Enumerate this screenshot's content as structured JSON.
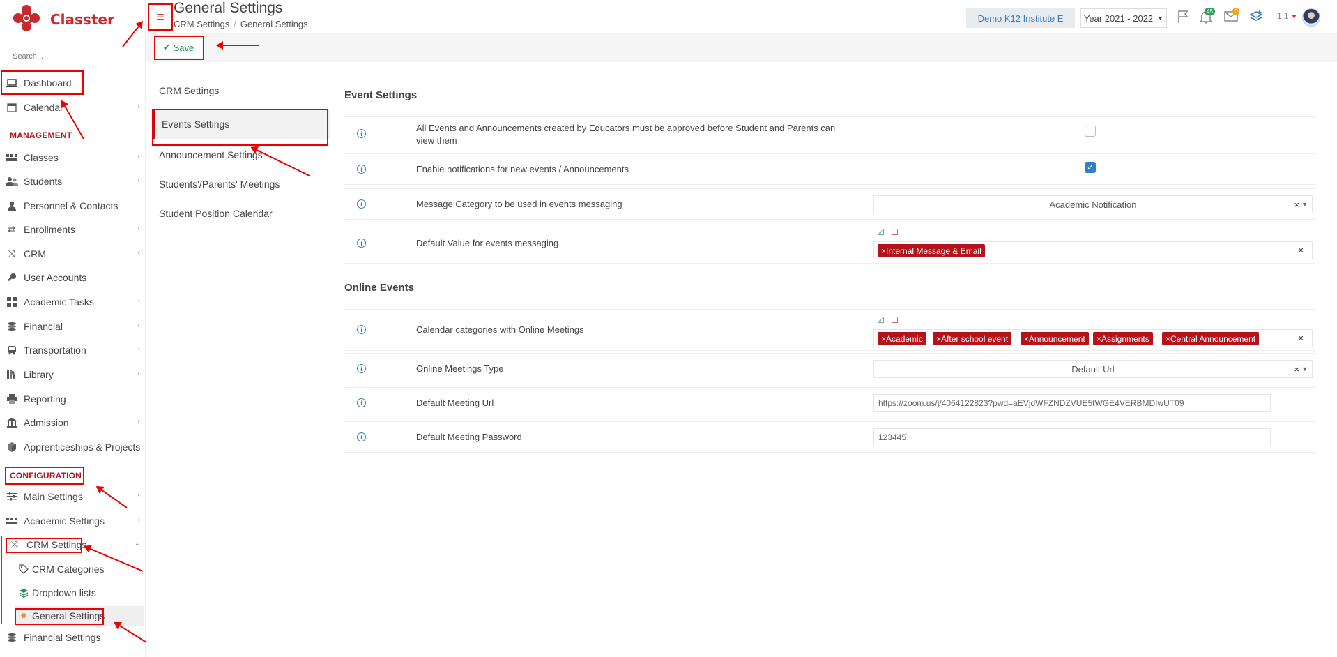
{
  "app": {
    "name": "Classter",
    "search_placeholder": "Search..."
  },
  "header": {
    "title": "General Settings",
    "breadcrumb": [
      "CRM Settings",
      "General Settings"
    ],
    "tenant": "Demo K12 Institute E",
    "year": "Year 2021 - 2022",
    "notifications_count": "45",
    "messages_count": "0",
    "user_label": "1 1"
  },
  "toolbar": {
    "save_label": "Save"
  },
  "sidebar": {
    "items": [
      {
        "label": "Dashboard"
      },
      {
        "label": "Calendar"
      },
      {
        "label": "Classes"
      },
      {
        "label": "Students"
      },
      {
        "label": "Personnel & Contacts"
      },
      {
        "label": "Enrollments"
      },
      {
        "label": "CRM"
      },
      {
        "label": "User Accounts"
      },
      {
        "label": "Academic Tasks"
      },
      {
        "label": "Financial"
      },
      {
        "label": "Transportation"
      },
      {
        "label": "Library"
      },
      {
        "label": "Reporting"
      },
      {
        "label": "Admission"
      },
      {
        "label": "Apprenticeships & Projects"
      },
      {
        "label": "Main Settings"
      },
      {
        "label": "Academic Settings"
      },
      {
        "label": "CRM Settings"
      },
      {
        "label": "Financial Settings"
      }
    ],
    "sections": {
      "management": "MANAGEMENT",
      "configuration": "CONFIGURATION"
    },
    "crm_sub": [
      {
        "label": "CRM Categories"
      },
      {
        "label": "Dropdown lists"
      },
      {
        "label": "General Settings"
      }
    ]
  },
  "settings_menu": [
    {
      "label": "CRM Settings"
    },
    {
      "label": "Events Settings"
    },
    {
      "label": "Announcement Settings"
    },
    {
      "label": "Students'/Parents' Meetings"
    },
    {
      "label": "Student Position Calendar"
    }
  ],
  "event_settings": {
    "title": "Event Settings",
    "approve_label": "All Events and Announcements created by Educators must be approved before Student and Parents can view them",
    "approve_checked": false,
    "notify_label": "Enable notifications for new events / Announcements",
    "notify_checked": true,
    "message_category_label": "Message Category to be used in events messaging",
    "message_category_value": "Academic Notification",
    "default_value_label": "Default Value for events messaging",
    "default_value_tags": [
      "Internal Message & Email"
    ]
  },
  "online_events": {
    "title": "Online Events",
    "calendar_label": "Calendar categories with Online Meetings",
    "calendar_tags": [
      "Academic",
      "After school event",
      "Announcement",
      "Assignments",
      "Central Announcement"
    ],
    "meetings_type_label": "Online Meetings Type",
    "meetings_type_value": "Default Url",
    "url_label": "Default Meeting Url",
    "url_value": "https://zoom.us/j/4064122823?pwd=aEVjdWFZNDZVUE5tWGE4VERBMDIwUT09",
    "password_label": "Default Meeting Password",
    "password_value": "123445"
  },
  "colors": {
    "brand": "#c9282d",
    "tag": "#b5121b",
    "link": "#3a7bbf",
    "save": "#2e8b57"
  }
}
